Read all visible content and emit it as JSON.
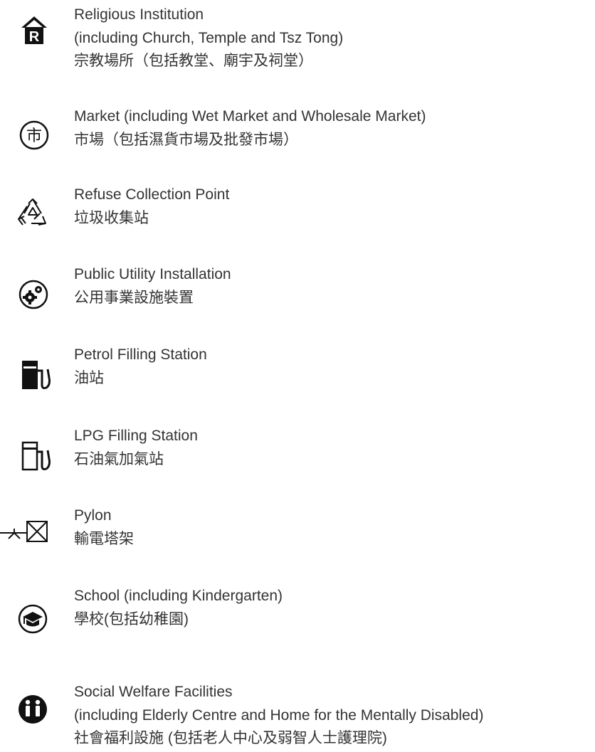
{
  "items": [
    {
      "icon": "religious-institution-icon",
      "lines": [
        "Religious Institution",
        "(including Church, Temple and Tsz Tong)",
        "宗教場所（包括教堂、廟宇及祠堂）"
      ]
    },
    {
      "icon": "market-icon",
      "lines": [
        "Market (including Wet Market and Wholesale Market)",
        "市場（包括濕貨市場及批發市場）"
      ]
    },
    {
      "icon": "recycling-icon",
      "lines": [
        "Refuse Collection Point",
        "垃圾收集站"
      ]
    },
    {
      "icon": "gears-icon",
      "lines": [
        "Public Utility Installation",
        "公用事業設施裝置"
      ]
    },
    {
      "icon": "petrol-pump-icon",
      "lines": [
        "Petrol Filling Station",
        "油站"
      ]
    },
    {
      "icon": "lpg-pump-icon",
      "lines": [
        "LPG Filling Station",
        "石油氣加氣站"
      ]
    },
    {
      "icon": "pylon-icon",
      "lines": [
        "Pylon",
        "輸電塔架"
      ]
    },
    {
      "icon": "mortarboard-icon",
      "lines": [
        "School (including Kindergarten)",
        "學校(包括幼稚園)"
      ]
    },
    {
      "icon": "social-welfare-icon",
      "lines": [
        "Social Welfare Facilities",
        "(including Elderly Centre and Home for the Mentally Disabled)",
        "社會福利設施 (包括老人中心及弱智人士護理院)"
      ]
    }
  ],
  "icon_color": "#111111",
  "text_color": "#333333"
}
